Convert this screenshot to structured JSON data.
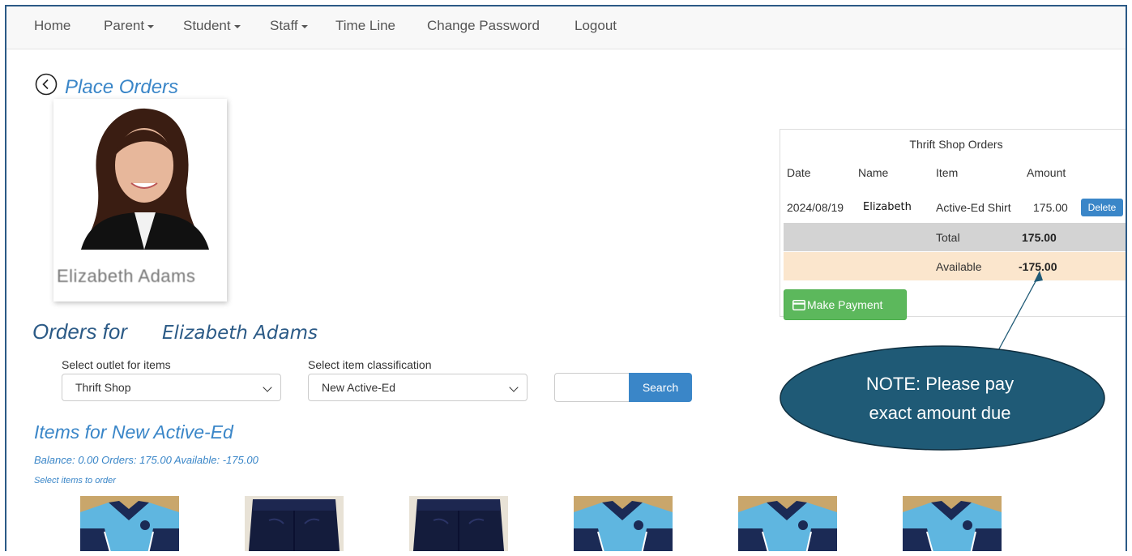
{
  "nav": {
    "items": [
      {
        "label": "Home",
        "dropdown": false
      },
      {
        "label": "Parent",
        "dropdown": true
      },
      {
        "label": "Student",
        "dropdown": true
      },
      {
        "label": "Staff",
        "dropdown": true
      },
      {
        "label": "Time Line",
        "dropdown": false
      },
      {
        "label": "Change Password",
        "dropdown": false
      },
      {
        "label": "Logout",
        "dropdown": false
      }
    ]
  },
  "page": {
    "title": "Place Orders",
    "back_icon": "chevron-left-circle-icon",
    "student_name": "Elizabeth Adams",
    "orders_for_label": "Orders for",
    "orders_for_name": "Elizabeth Adams"
  },
  "filters": {
    "outlet_label": "Select outlet for items",
    "outlet_value": "Thrift Shop",
    "classification_label": "Select item classification",
    "classification_value": "New Active-Ed",
    "search_value": "",
    "search_button": "Search"
  },
  "items": {
    "title": "Items for New Active-Ed",
    "balance_line": "Balance: 0.00 Orders: 175.00 Available: -175.00",
    "hint": "Select items to order",
    "thumbnails": [
      "shirt",
      "shorts",
      "shorts",
      "shirt",
      "shirt",
      "shirt"
    ]
  },
  "orders_panel": {
    "title": "Thrift Shop Orders",
    "headers": {
      "date": "Date",
      "name": "Name",
      "item": "Item",
      "amount": "Amount"
    },
    "row": {
      "date": "2024/08/19",
      "name": "Elizabeth",
      "item": "Active-Ed Shirt",
      "amount": "175.00",
      "delete": "Delete"
    },
    "total_label": "Total",
    "total_value": "175.00",
    "available_label": "Available",
    "available_value": "-175.00",
    "pay_button": "Make Payment",
    "pay_icon": "credit-card-icon"
  },
  "callout": {
    "line1": "NOTE: Please pay",
    "line2": "exact amount due",
    "fill_color": "#1f5a76"
  },
  "colors": {
    "link_blue": "#3a86c8",
    "heading_blue": "#2b5a86",
    "success_green": "#5cb85c",
    "total_row": "#d3d3d3",
    "available_row": "#fbe6cd"
  }
}
